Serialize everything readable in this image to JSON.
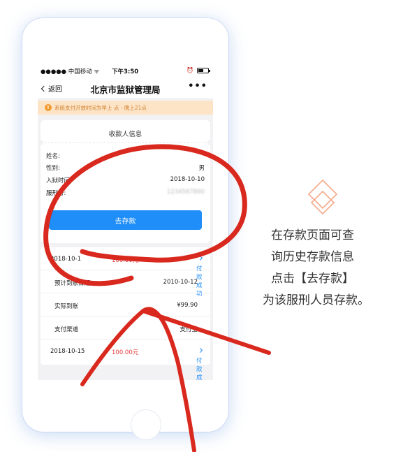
{
  "status_bar": {
    "carrier": "●●●●● 中国移动 ᯤ",
    "time": "下午3:50"
  },
  "nav": {
    "back_label": "返回",
    "title": "北京市监狱管理局",
    "more": "•••"
  },
  "notice": {
    "text": "系统支付开放时间为早上  点 - 晚上21点"
  },
  "card": {
    "title": "收款人信息",
    "fields": [
      {
        "label": "姓名:",
        "value": ""
      },
      {
        "label": "性别:",
        "value": "男"
      },
      {
        "label": "入狱时间:",
        "value": "2018-10-10"
      },
      {
        "label": "服刑号:",
        "value": "1234567890"
      }
    ],
    "button_label": "去存款"
  },
  "history": {
    "rows": [
      {
        "left": "2018-10-1",
        "amount": "100.00元",
        "status": "付款成功"
      },
      {
        "left": "预计到账日期",
        "right": "2010-10-12"
      },
      {
        "left": "实际到账",
        "right": "¥99.90"
      },
      {
        "left": "支付渠道",
        "right": "支付宝"
      },
      {
        "left": "2018-10-15",
        "amount": "100.00元",
        "status": "付款成功"
      }
    ]
  },
  "side_text": [
    "在存款页面可查",
    "询历史存款信息",
    "点击【去存款】",
    "为该服刑人员存款。"
  ],
  "colors": {
    "accent": "#1f8ef8",
    "notice_bg": "#fde4c6",
    "scribble": "#d9281d",
    "logo": "#f5a98a"
  }
}
